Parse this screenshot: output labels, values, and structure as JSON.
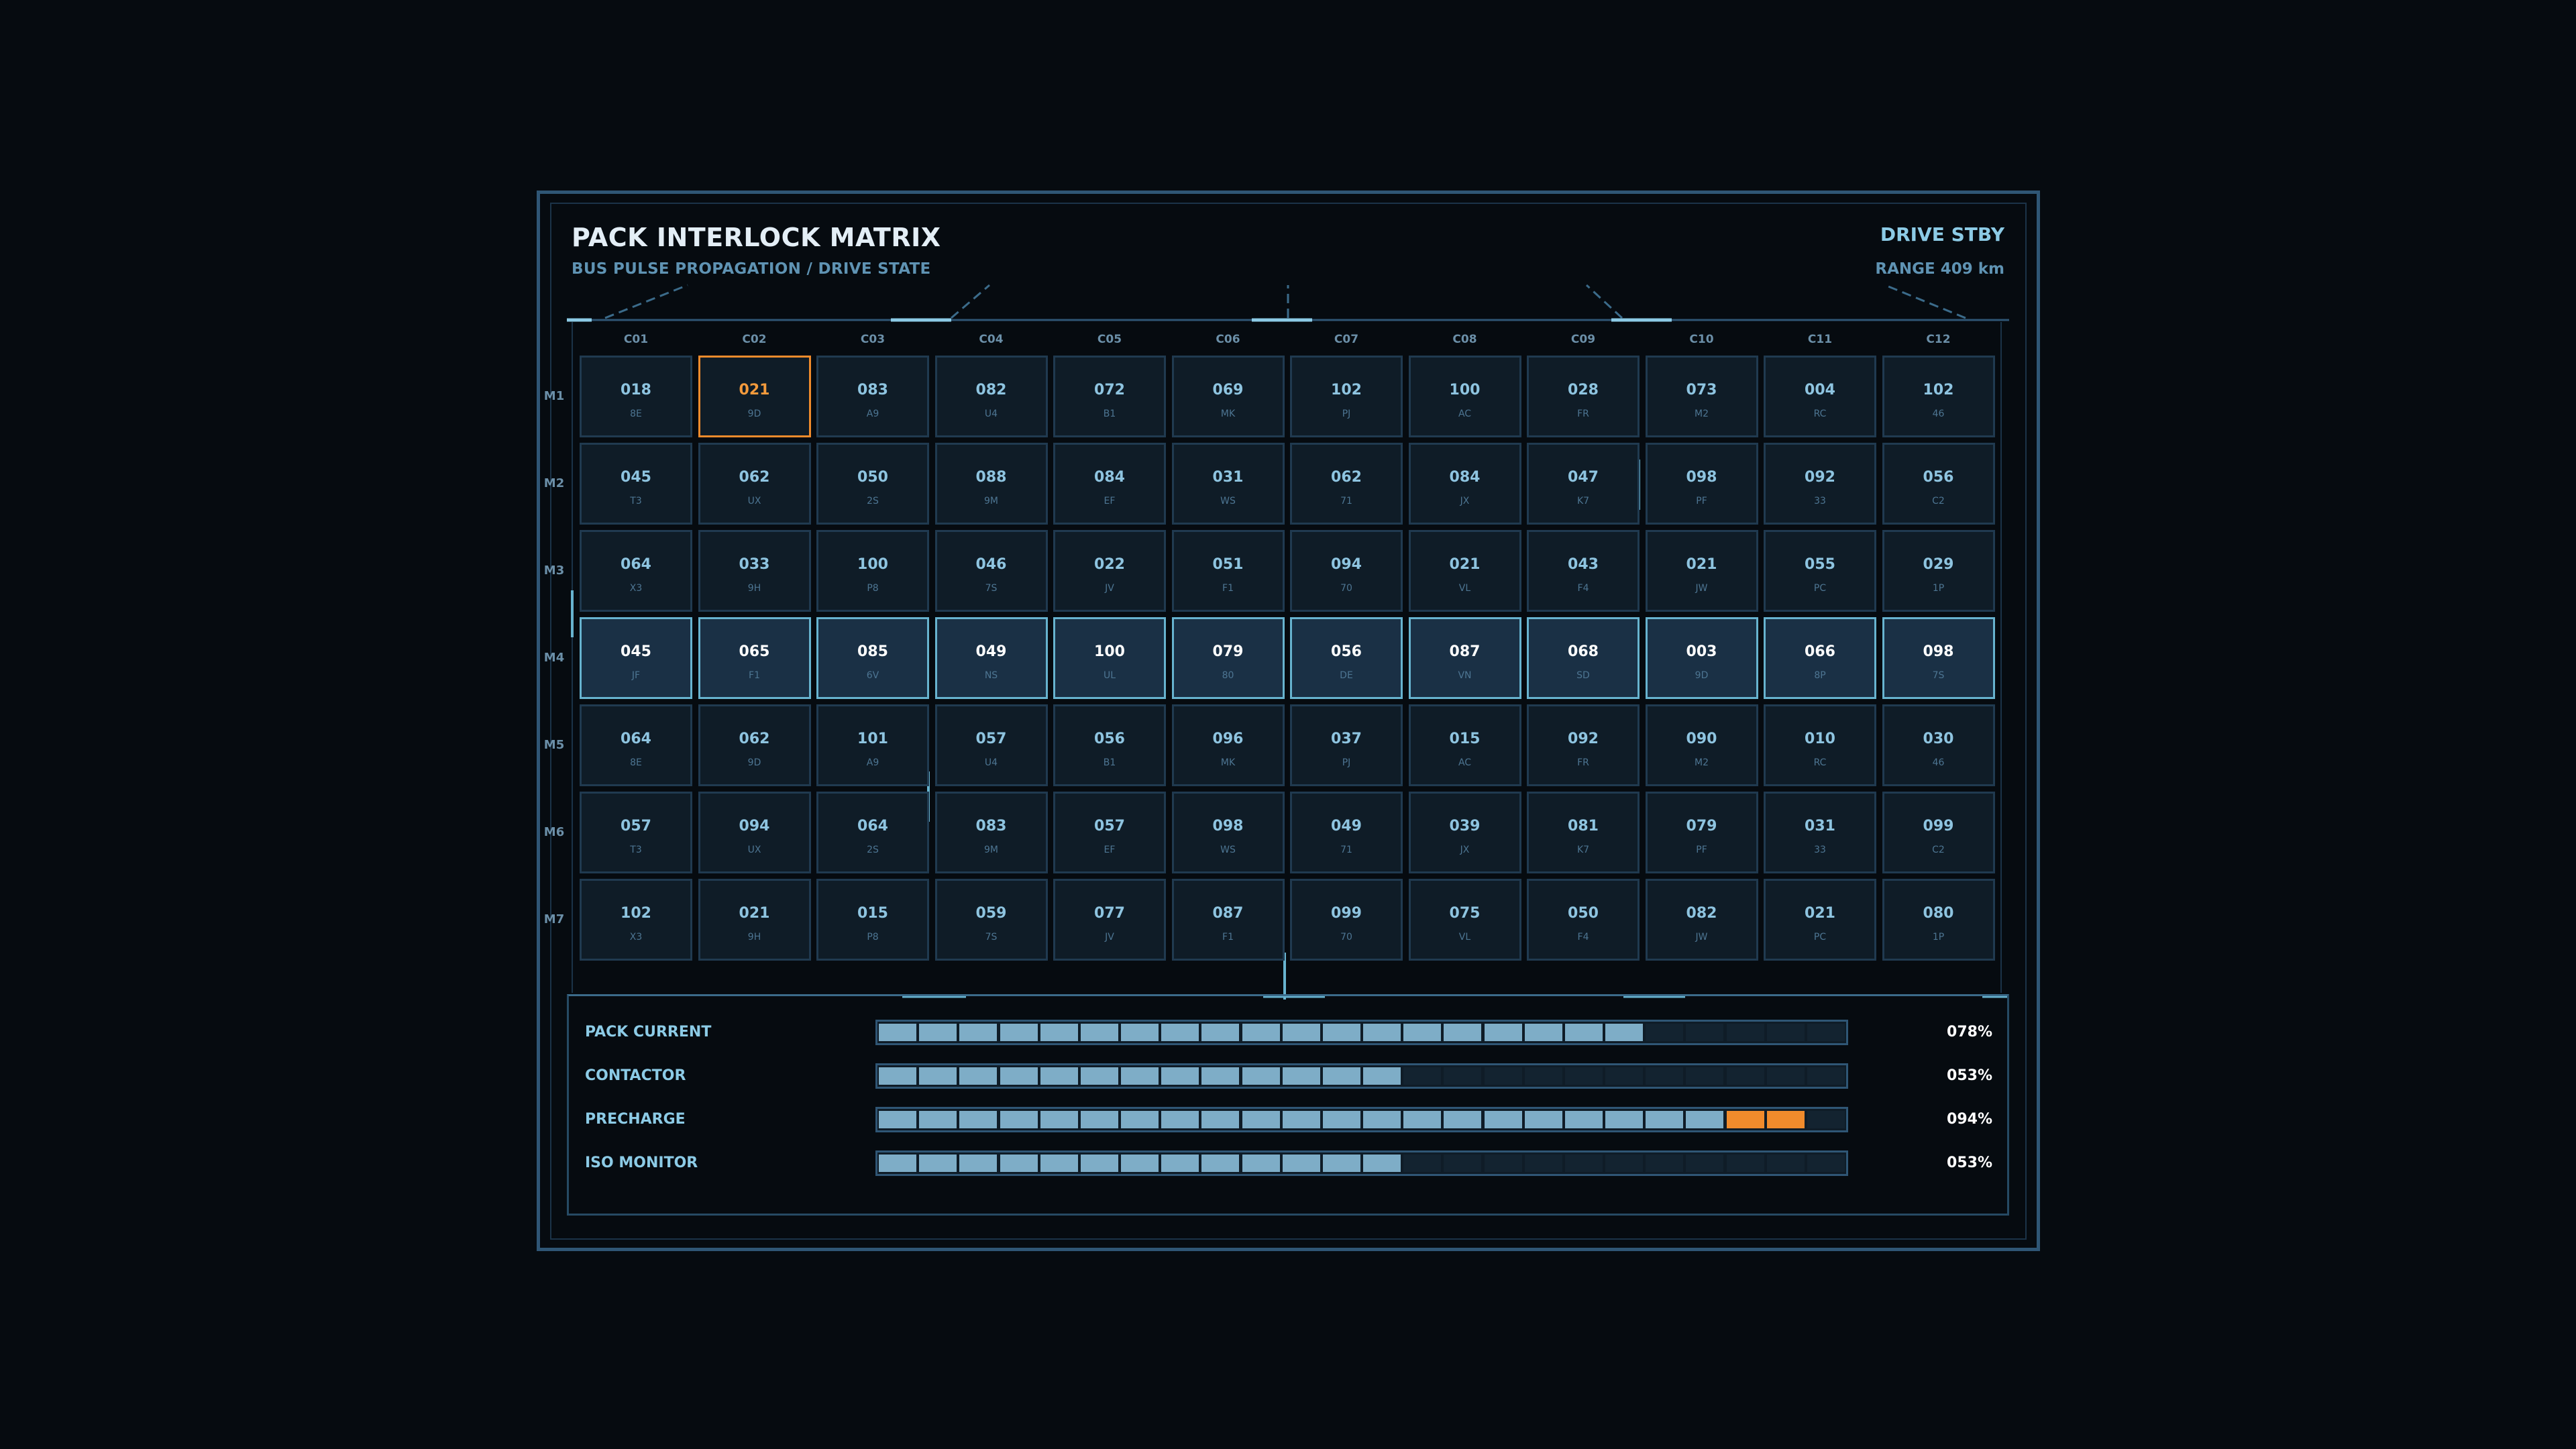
{
  "header": {
    "title": "PACK INTERLOCK MATRIX",
    "subtitle": "BUS PULSE PROPAGATION / DRIVE STATE",
    "drive_state": "DRIVE STBY",
    "range": "RANGE 409 km"
  },
  "colors": {
    "accent": "#8ccbe6",
    "alert": "#f08b2c",
    "cell_bg": "#0f1c27",
    "frame": "#2f5675"
  },
  "matrix": {
    "columns": [
      "C01",
      "C02",
      "C03",
      "C04",
      "C05",
      "C06",
      "C07",
      "C08",
      "C09",
      "C10",
      "C11",
      "C12"
    ],
    "rows": [
      {
        "label": "M1",
        "highlight": false,
        "cells": [
          {
            "value": "018",
            "code": "8E"
          },
          {
            "value": "021",
            "code": "9D",
            "selected": true
          },
          {
            "value": "083",
            "code": "A9"
          },
          {
            "value": "082",
            "code": "U4"
          },
          {
            "value": "072",
            "code": "B1"
          },
          {
            "value": "069",
            "code": "MK"
          },
          {
            "value": "102",
            "code": "PJ"
          },
          {
            "value": "100",
            "code": "AC"
          },
          {
            "value": "028",
            "code": "FR"
          },
          {
            "value": "073",
            "code": "M2"
          },
          {
            "value": "004",
            "code": "RC"
          },
          {
            "value": "102",
            "code": "46"
          }
        ]
      },
      {
        "label": "M2",
        "highlight": false,
        "cells": [
          {
            "value": "045",
            "code": "T3"
          },
          {
            "value": "062",
            "code": "UX"
          },
          {
            "value": "050",
            "code": "2S"
          },
          {
            "value": "088",
            "code": "9M"
          },
          {
            "value": "084",
            "code": "EF"
          },
          {
            "value": "031",
            "code": "WS"
          },
          {
            "value": "062",
            "code": "71"
          },
          {
            "value": "084",
            "code": "JX"
          },
          {
            "value": "047",
            "code": "K7"
          },
          {
            "value": "098",
            "code": "PF"
          },
          {
            "value": "092",
            "code": "33"
          },
          {
            "value": "056",
            "code": "C2"
          }
        ]
      },
      {
        "label": "M3",
        "highlight": false,
        "cells": [
          {
            "value": "064",
            "code": "X3"
          },
          {
            "value": "033",
            "code": "9H"
          },
          {
            "value": "100",
            "code": "P8"
          },
          {
            "value": "046",
            "code": "7S"
          },
          {
            "value": "022",
            "code": "JV"
          },
          {
            "value": "051",
            "code": "F1"
          },
          {
            "value": "094",
            "code": "70"
          },
          {
            "value": "021",
            "code": "VL"
          },
          {
            "value": "043",
            "code": "F4"
          },
          {
            "value": "021",
            "code": "JW"
          },
          {
            "value": "055",
            "code": "PC"
          },
          {
            "value": "029",
            "code": "1P"
          }
        ]
      },
      {
        "label": "M4",
        "highlight": true,
        "cells": [
          {
            "value": "045",
            "code": "JF"
          },
          {
            "value": "065",
            "code": "F1"
          },
          {
            "value": "085",
            "code": "6V"
          },
          {
            "value": "049",
            "code": "NS"
          },
          {
            "value": "100",
            "code": "UL"
          },
          {
            "value": "079",
            "code": "80"
          },
          {
            "value": "056",
            "code": "DE"
          },
          {
            "value": "087",
            "code": "VN"
          },
          {
            "value": "068",
            "code": "SD"
          },
          {
            "value": "003",
            "code": "9D"
          },
          {
            "value": "066",
            "code": "8P"
          },
          {
            "value": "098",
            "code": "7S"
          }
        ]
      },
      {
        "label": "M5",
        "highlight": false,
        "cells": [
          {
            "value": "064",
            "code": "8E"
          },
          {
            "value": "062",
            "code": "9D"
          },
          {
            "value": "101",
            "code": "A9"
          },
          {
            "value": "057",
            "code": "U4"
          },
          {
            "value": "056",
            "code": "B1"
          },
          {
            "value": "096",
            "code": "MK"
          },
          {
            "value": "037",
            "code": "PJ"
          },
          {
            "value": "015",
            "code": "AC"
          },
          {
            "value": "092",
            "code": "FR"
          },
          {
            "value": "090",
            "code": "M2"
          },
          {
            "value": "010",
            "code": "RC"
          },
          {
            "value": "030",
            "code": "46"
          }
        ]
      },
      {
        "label": "M6",
        "highlight": false,
        "cells": [
          {
            "value": "057",
            "code": "T3"
          },
          {
            "value": "094",
            "code": "UX"
          },
          {
            "value": "064",
            "code": "2S"
          },
          {
            "value": "083",
            "code": "9M"
          },
          {
            "value": "057",
            "code": "EF"
          },
          {
            "value": "098",
            "code": "WS"
          },
          {
            "value": "049",
            "code": "71"
          },
          {
            "value": "039",
            "code": "JX"
          },
          {
            "value": "081",
            "code": "K7"
          },
          {
            "value": "079",
            "code": "PF"
          },
          {
            "value": "031",
            "code": "33"
          },
          {
            "value": "099",
            "code": "C2"
          }
        ]
      },
      {
        "label": "M7",
        "highlight": false,
        "cells": [
          {
            "value": "102",
            "code": "X3"
          },
          {
            "value": "021",
            "code": "9H"
          },
          {
            "value": "015",
            "code": "P8"
          },
          {
            "value": "059",
            "code": "7S"
          },
          {
            "value": "077",
            "code": "JV"
          },
          {
            "value": "087",
            "code": "F1"
          },
          {
            "value": "099",
            "code": "70"
          },
          {
            "value": "075",
            "code": "VL"
          },
          {
            "value": "050",
            "code": "F4"
          },
          {
            "value": "082",
            "code": "JW"
          },
          {
            "value": "021",
            "code": "PC"
          },
          {
            "value": "080",
            "code": "1P"
          }
        ]
      }
    ]
  },
  "gauges": [
    {
      "label": "PACK CURRENT",
      "value": "078%",
      "filled_segments": 19,
      "alert_segments": 0,
      "total_segments": 24
    },
    {
      "label": "CONTACTOR",
      "value": "053%",
      "filled_segments": 13,
      "alert_segments": 0,
      "total_segments": 24
    },
    {
      "label": "PRECHARGE",
      "value": "094%",
      "filled_segments": 21,
      "alert_segments": 2,
      "total_segments": 24
    },
    {
      "label": "ISO MONITOR",
      "value": "053%",
      "filled_segments": 13,
      "alert_segments": 0,
      "total_segments": 24
    }
  ]
}
